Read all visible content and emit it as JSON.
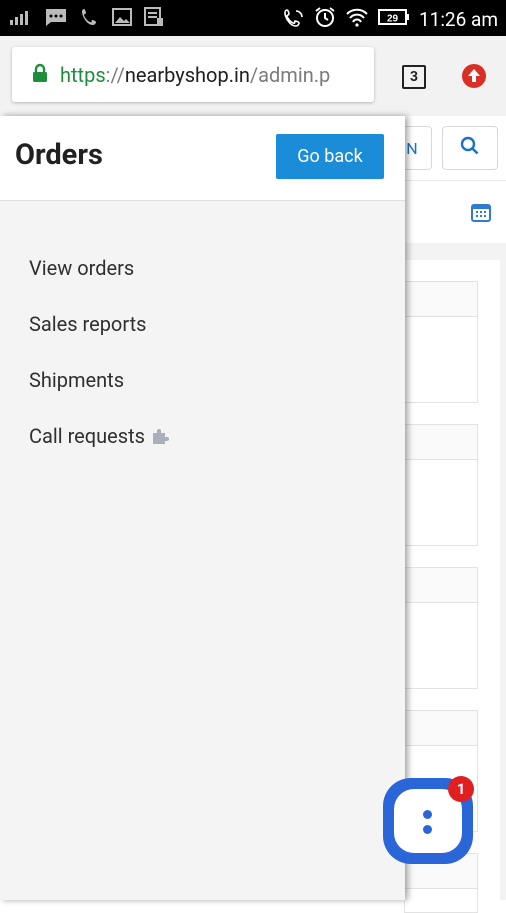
{
  "status_bar": {
    "time": "11:26 am",
    "battery": "29"
  },
  "browser": {
    "url_scheme": "https",
    "url_sep": "://",
    "url_host": "nearbyshop.in",
    "url_path": "/admin.p",
    "tab_count": "3"
  },
  "background_page": {
    "partial_button_label": "N"
  },
  "drawer": {
    "title": "Orders",
    "go_back_label": "Go back",
    "menu": [
      {
        "label": "View orders"
      },
      {
        "label": "Sales reports"
      },
      {
        "label": "Shipments"
      },
      {
        "label": "Call requests"
      }
    ]
  },
  "chat_widget": {
    "badge_count": "1"
  },
  "colors": {
    "primary_blue": "#1a8cd8",
    "chat_blue": "#2b66d9",
    "badge_red": "#e02020",
    "secure_green": "#1e8e3e"
  }
}
